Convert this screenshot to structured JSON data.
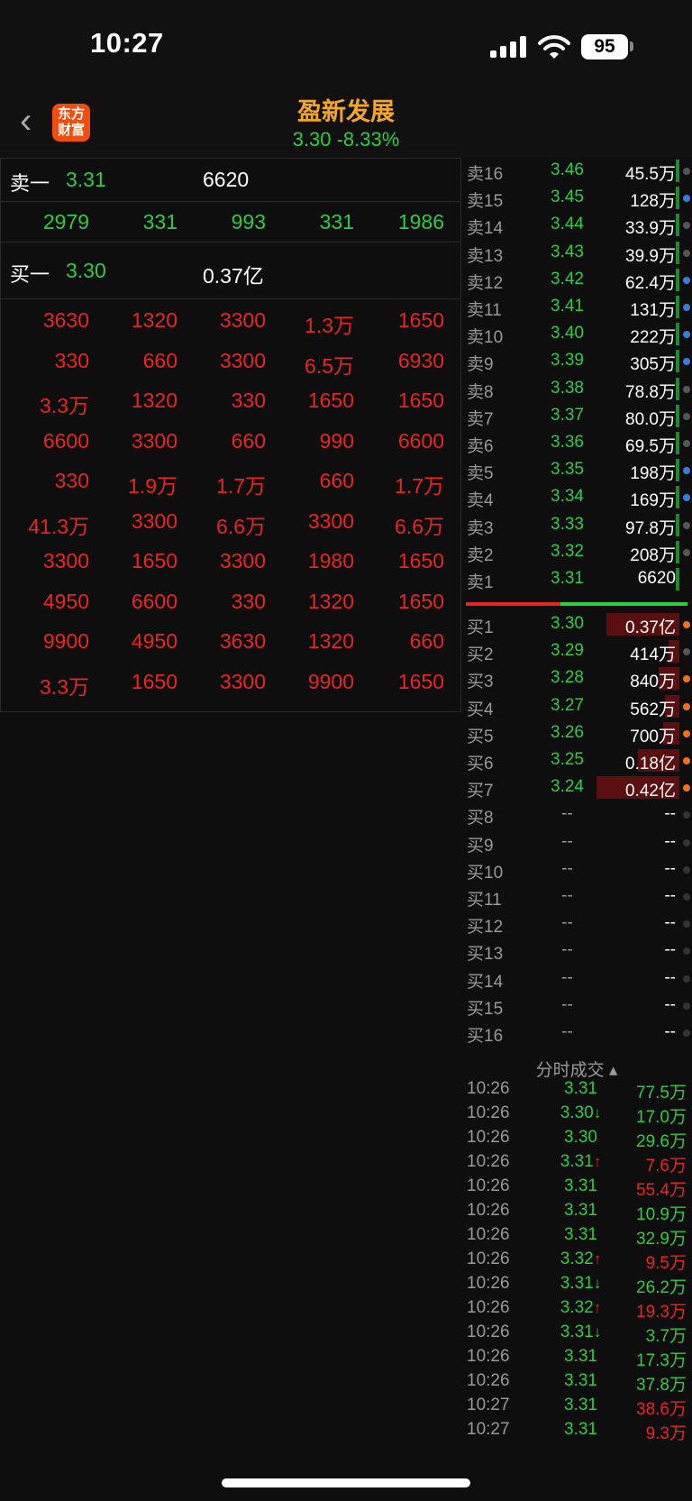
{
  "status_bar": {
    "time": "10:27",
    "battery": "95"
  },
  "header": {
    "logo_text": "东方\n财富",
    "stock_name": "盈新发展",
    "price_line": "3.30  -8.33%",
    "back_symbol": "‹"
  },
  "left_panel": {
    "sell_row": {
      "label": "卖一",
      "price": "3.31",
      "volume": "6620"
    },
    "sell_queue": [
      "2979",
      "331",
      "993",
      "331",
      "1986"
    ],
    "buy_row": {
      "label": "买一",
      "price": "3.30",
      "volume": "0.37亿"
    },
    "buy_queue": [
      [
        "3630",
        "1320",
        "3300",
        "1.3万",
        "1650"
      ],
      [
        "330",
        "660",
        "3300",
        "6.5万",
        "6930"
      ],
      [
        "3.3万",
        "1320",
        "330",
        "1650",
        "1650"
      ],
      [
        "6600",
        "3300",
        "660",
        "990",
        "6600"
      ],
      [
        "330",
        "1.9万",
        "1.7万",
        "660",
        "1.7万"
      ],
      [
        "41.3万",
        "3300",
        "6.6万",
        "3300",
        "6.6万"
      ],
      [
        "3300",
        "1650",
        "3300",
        "1980",
        "1650"
      ],
      [
        "4950",
        "6600",
        "330",
        "1320",
        "1650"
      ],
      [
        "9900",
        "4950",
        "3630",
        "1320",
        "660"
      ],
      [
        "3.3万",
        "1650",
        "3300",
        "9900",
        "1650"
      ]
    ]
  },
  "order_book": {
    "asks": [
      {
        "label": "卖16",
        "price": "3.46",
        "volume": "45.5万",
        "dot": "#555"
      },
      {
        "label": "卖15",
        "price": "3.45",
        "volume": "128万",
        "dot": "#3a7be0"
      },
      {
        "label": "卖14",
        "price": "3.44",
        "volume": "33.9万",
        "dot": "#555"
      },
      {
        "label": "卖13",
        "price": "3.43",
        "volume": "39.9万",
        "dot": "#555"
      },
      {
        "label": "卖12",
        "price": "3.42",
        "volume": "62.4万",
        "dot": "#3a7be0"
      },
      {
        "label": "卖11",
        "price": "3.41",
        "volume": "131万",
        "dot": "#3a7be0"
      },
      {
        "label": "卖10",
        "price": "3.40",
        "volume": "222万",
        "dot": "#3a7be0"
      },
      {
        "label": "卖9",
        "price": "3.39",
        "volume": "305万",
        "dot": "#3a7be0"
      },
      {
        "label": "卖8",
        "price": "3.38",
        "volume": "78.8万",
        "dot": "#555"
      },
      {
        "label": "卖7",
        "price": "3.37",
        "volume": "80.0万",
        "dot": "#555"
      },
      {
        "label": "卖6",
        "price": "3.36",
        "volume": "69.5万",
        "dot": "#555"
      },
      {
        "label": "卖5",
        "price": "3.35",
        "volume": "198万",
        "dot": "#3a7be0"
      },
      {
        "label": "卖4",
        "price": "3.34",
        "volume": "169万",
        "dot": "#3a7be0"
      },
      {
        "label": "卖3",
        "price": "3.33",
        "volume": "97.8万",
        "dot": "#555"
      },
      {
        "label": "卖2",
        "price": "3.32",
        "volume": "208万",
        "dot": "#555"
      },
      {
        "label": "卖1",
        "price": "3.31",
        "volume": "6620",
        "dot": ""
      }
    ],
    "bids": [
      {
        "label": "买1",
        "price": "3.30",
        "volume": "0.37亿",
        "bar": 0.35,
        "dot": "#f07020"
      },
      {
        "label": "买2",
        "price": "3.29",
        "volume": "414万",
        "bar": 0.05,
        "dot": "#555"
      },
      {
        "label": "买3",
        "price": "3.28",
        "volume": "840万",
        "bar": 0.1,
        "dot": "#f07020"
      },
      {
        "label": "买4",
        "price": "3.27",
        "volume": "562万",
        "bar": 0.07,
        "dot": "#f07020"
      },
      {
        "label": "买5",
        "price": "3.26",
        "volume": "700万",
        "bar": 0.08,
        "dot": "#f07020"
      },
      {
        "label": "买6",
        "price": "3.25",
        "volume": "0.18亿",
        "bar": 0.2,
        "dot": "#f07020"
      },
      {
        "label": "买7",
        "price": "3.24",
        "volume": "0.42亿",
        "bar": 0.4,
        "dot": "#f07020"
      },
      {
        "label": "买8",
        "price": "--",
        "volume": "--",
        "bar": 0,
        "dot": "#333"
      },
      {
        "label": "买9",
        "price": "--",
        "volume": "--",
        "bar": 0,
        "dot": "#333"
      },
      {
        "label": "买10",
        "price": "--",
        "volume": "--",
        "bar": 0,
        "dot": "#333"
      },
      {
        "label": "买11",
        "price": "--",
        "volume": "--",
        "bar": 0,
        "dot": "#333"
      },
      {
        "label": "买12",
        "price": "--",
        "volume": "--",
        "bar": 0,
        "dot": "#333"
      },
      {
        "label": "买13",
        "price": "--",
        "volume": "--",
        "bar": 0,
        "dot": "#333"
      },
      {
        "label": "买14",
        "price": "--",
        "volume": "--",
        "bar": 0,
        "dot": "#333"
      },
      {
        "label": "买15",
        "price": "--",
        "volume": "--",
        "bar": 0,
        "dot": "#333"
      },
      {
        "label": "买16",
        "price": "--",
        "volume": "--",
        "bar": 0,
        "dot": "#333"
      }
    ]
  },
  "trades": {
    "title": "分时成交 ▴",
    "rows": [
      {
        "time": "10:26",
        "price": "3.31",
        "arrow": "",
        "volume": "77.5万",
        "vcolor": "green"
      },
      {
        "time": "10:26",
        "price": "3.30",
        "arrow": "↓",
        "volume": "17.0万",
        "vcolor": "green"
      },
      {
        "time": "10:26",
        "price": "3.30",
        "arrow": "",
        "volume": "29.6万",
        "vcolor": "green"
      },
      {
        "time": "10:26",
        "price": "3.31",
        "arrow": "↑",
        "volume": "7.6万",
        "vcolor": "red"
      },
      {
        "time": "10:26",
        "price": "3.31",
        "arrow": "",
        "volume": "55.4万",
        "vcolor": "red"
      },
      {
        "time": "10:26",
        "price": "3.31",
        "arrow": "",
        "volume": "10.9万",
        "vcolor": "green"
      },
      {
        "time": "10:26",
        "price": "3.31",
        "arrow": "",
        "volume": "32.9万",
        "vcolor": "green"
      },
      {
        "time": "10:26",
        "price": "3.32",
        "arrow": "↑",
        "volume": "9.5万",
        "vcolor": "red"
      },
      {
        "time": "10:26",
        "price": "3.31",
        "arrow": "↓",
        "volume": "26.2万",
        "vcolor": "green"
      },
      {
        "time": "10:26",
        "price": "3.32",
        "arrow": "↑",
        "volume": "19.3万",
        "vcolor": "red"
      },
      {
        "time": "10:26",
        "price": "3.31",
        "arrow": "↓",
        "volume": "3.7万",
        "vcolor": "green"
      },
      {
        "time": "10:26",
        "price": "3.31",
        "arrow": "",
        "volume": "17.3万",
        "vcolor": "green"
      },
      {
        "time": "10:26",
        "price": "3.31",
        "arrow": "",
        "volume": "37.8万",
        "vcolor": "green"
      },
      {
        "time": "10:27",
        "price": "3.31",
        "arrow": "",
        "volume": "38.6万",
        "vcolor": "red"
      },
      {
        "time": "10:27",
        "price": "3.31",
        "arrow": "",
        "volume": "9.3万",
        "vcolor": "red"
      }
    ]
  }
}
